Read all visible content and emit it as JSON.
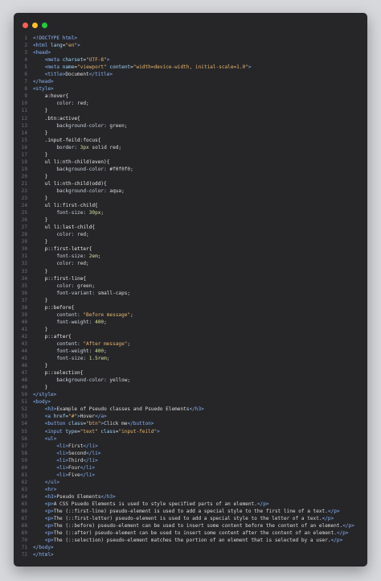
{
  "window": {
    "controls": [
      {
        "name": "close",
        "color": "#ff5f56"
      },
      {
        "name": "minimize",
        "color": "#ffbd2e"
      },
      {
        "name": "maximize",
        "color": "#27c93f"
      }
    ]
  },
  "code_lines": [
    [
      [
        "tag",
        "<!DOCTYPE html>"
      ]
    ],
    [
      [
        "tag",
        "<html "
      ],
      [
        "attr",
        "lang"
      ],
      [
        "plain",
        "="
      ],
      [
        "str",
        "\"en\""
      ],
      [
        "tag",
        ">"
      ]
    ],
    [
      [
        "tag",
        "<head>"
      ]
    ],
    [
      [
        "plain",
        "    "
      ],
      [
        "tag",
        "<meta "
      ],
      [
        "attr",
        "charset"
      ],
      [
        "plain",
        "="
      ],
      [
        "str",
        "\"UTF-8\""
      ],
      [
        "tag",
        ">"
      ]
    ],
    [
      [
        "plain",
        "    "
      ],
      [
        "tag",
        "<meta "
      ],
      [
        "attr",
        "name"
      ],
      [
        "plain",
        "="
      ],
      [
        "str",
        "\"viewport\""
      ],
      [
        "plain",
        " "
      ],
      [
        "attr",
        "content"
      ],
      [
        "plain",
        "="
      ],
      [
        "str",
        "\"width=device-width, initial-scale=1.0\""
      ],
      [
        "tag",
        ">"
      ]
    ],
    [
      [
        "plain",
        "    "
      ],
      [
        "tag",
        "<title>"
      ],
      [
        "plain",
        "Document"
      ],
      [
        "tag",
        "</title>"
      ]
    ],
    [
      [
        "tag",
        "</head>"
      ]
    ],
    [
      [
        "tag",
        "<style>"
      ]
    ],
    [
      [
        "plain",
        "    "
      ],
      [
        "sel",
        "a:hover{"
      ]
    ],
    [
      [
        "plain",
        "        "
      ],
      [
        "prop",
        "color"
      ],
      [
        "plain",
        ": "
      ],
      [
        "plain",
        "red;"
      ]
    ],
    [
      [
        "plain",
        "    "
      ],
      [
        "sel",
        "}"
      ]
    ],
    [
      [
        "plain",
        "    "
      ],
      [
        "sel",
        ".btn:active{"
      ]
    ],
    [
      [
        "plain",
        "        "
      ],
      [
        "prop",
        "background-color"
      ],
      [
        "plain",
        ": "
      ],
      [
        "plain",
        "green;"
      ]
    ],
    [
      [
        "plain",
        "    "
      ],
      [
        "sel",
        "}"
      ]
    ],
    [
      [
        "plain",
        "    "
      ],
      [
        "sel",
        ".input-feild:focus{"
      ]
    ],
    [
      [
        "plain",
        "        "
      ],
      [
        "prop",
        "border"
      ],
      [
        "plain",
        ": "
      ],
      [
        "num",
        "3px"
      ],
      [
        "plain",
        " solid red;"
      ]
    ],
    [
      [
        "plain",
        "    "
      ],
      [
        "sel",
        "}"
      ]
    ],
    [
      [
        "plain",
        "    "
      ],
      [
        "sel",
        "ul li:nth-child(even){"
      ]
    ],
    [
      [
        "plain",
        "        "
      ],
      [
        "prop",
        "background-color"
      ],
      [
        "plain",
        ": "
      ],
      [
        "plain",
        "#f0f0f0;"
      ]
    ],
    [
      [
        "plain",
        "    "
      ],
      [
        "sel",
        "}"
      ]
    ],
    [
      [
        "plain",
        "    "
      ],
      [
        "sel",
        "ul li:nth-child(odd){"
      ]
    ],
    [
      [
        "plain",
        "        "
      ],
      [
        "prop",
        "background-color"
      ],
      [
        "plain",
        ": "
      ],
      [
        "plain",
        "aqua;"
      ]
    ],
    [
      [
        "plain",
        "    "
      ],
      [
        "sel",
        "}"
      ]
    ],
    [
      [
        "plain",
        "    "
      ],
      [
        "sel",
        "ul li:first-child{"
      ]
    ],
    [
      [
        "plain",
        "        "
      ],
      [
        "prop",
        "font-size"
      ],
      [
        "plain",
        ": "
      ],
      [
        "num",
        "30px"
      ],
      [
        "plain",
        ";"
      ]
    ],
    [
      [
        "plain",
        "    "
      ],
      [
        "sel",
        "}"
      ]
    ],
    [
      [
        "plain",
        "    "
      ],
      [
        "sel",
        "ul li:last-child{"
      ]
    ],
    [
      [
        "plain",
        "        "
      ],
      [
        "prop",
        "color"
      ],
      [
        "plain",
        ": "
      ],
      [
        "plain",
        "red;"
      ]
    ],
    [
      [
        "plain",
        "    "
      ],
      [
        "sel",
        "}"
      ]
    ],
    [
      [
        "plain",
        "    "
      ],
      [
        "sel",
        "p::first-letter{"
      ]
    ],
    [
      [
        "plain",
        "        "
      ],
      [
        "prop",
        "font-size"
      ],
      [
        "plain",
        ": "
      ],
      [
        "num",
        "2em"
      ],
      [
        "plain",
        ";"
      ]
    ],
    [
      [
        "plain",
        "        "
      ],
      [
        "prop",
        "color"
      ],
      [
        "plain",
        ": "
      ],
      [
        "plain",
        "red;"
      ]
    ],
    [
      [
        "plain",
        "    "
      ],
      [
        "sel",
        "}"
      ]
    ],
    [
      [
        "plain",
        "    "
      ],
      [
        "sel",
        "p::first-line{"
      ]
    ],
    [
      [
        "plain",
        "        "
      ],
      [
        "prop",
        "color"
      ],
      [
        "plain",
        ": "
      ],
      [
        "plain",
        "green;"
      ]
    ],
    [
      [
        "plain",
        "        "
      ],
      [
        "prop",
        "font-variant"
      ],
      [
        "plain",
        ": "
      ],
      [
        "plain",
        "small-caps;"
      ]
    ],
    [
      [
        "plain",
        "    "
      ],
      [
        "sel",
        "}"
      ]
    ],
    [
      [
        "plain",
        "    "
      ],
      [
        "sel",
        "p::before{"
      ]
    ],
    [
      [
        "plain",
        "        "
      ],
      [
        "prop",
        "content"
      ],
      [
        "plain",
        ": "
      ],
      [
        "str",
        "\"Before message\""
      ],
      [
        "plain",
        ";"
      ]
    ],
    [
      [
        "plain",
        "        "
      ],
      [
        "prop",
        "font-weight"
      ],
      [
        "plain",
        ": "
      ],
      [
        "num",
        "400"
      ],
      [
        "plain",
        ";"
      ]
    ],
    [
      [
        "plain",
        "    "
      ],
      [
        "sel",
        "}"
      ]
    ],
    [
      [
        "plain",
        "    "
      ],
      [
        "sel",
        "p::after{"
      ]
    ],
    [
      [
        "plain",
        "        "
      ],
      [
        "prop",
        "content"
      ],
      [
        "plain",
        ": "
      ],
      [
        "str",
        "\"After message\""
      ],
      [
        "plain",
        ";"
      ]
    ],
    [
      [
        "plain",
        "        "
      ],
      [
        "prop",
        "font-weight"
      ],
      [
        "plain",
        ": "
      ],
      [
        "num",
        "400"
      ],
      [
        "plain",
        ";"
      ]
    ],
    [
      [
        "plain",
        "        "
      ],
      [
        "prop",
        "font-size"
      ],
      [
        "plain",
        ": "
      ],
      [
        "num",
        "1.5rem"
      ],
      [
        "plain",
        ";"
      ]
    ],
    [
      [
        "plain",
        "    "
      ],
      [
        "sel",
        "}"
      ]
    ],
    [
      [
        "plain",
        "    "
      ],
      [
        "sel",
        "p::selection{"
      ]
    ],
    [
      [
        "plain",
        "        "
      ],
      [
        "prop",
        "background-color"
      ],
      [
        "plain",
        ": "
      ],
      [
        "plain",
        "yellow;"
      ]
    ],
    [
      [
        "plain",
        "    "
      ],
      [
        "sel",
        "}"
      ]
    ],
    [
      [
        "tag",
        "</style>"
      ]
    ],
    [
      [
        "tag",
        "<body>"
      ]
    ],
    [
      [
        "plain",
        "    "
      ],
      [
        "tag",
        "<h3>"
      ],
      [
        "plain",
        "Example of Pseudo classes and Psuedo Elements"
      ],
      [
        "tag",
        "</h3>"
      ]
    ],
    [
      [
        "plain",
        "    "
      ],
      [
        "tag",
        "<a "
      ],
      [
        "attr",
        "href"
      ],
      [
        "plain",
        "="
      ],
      [
        "str",
        "\"#\""
      ],
      [
        "tag",
        ">"
      ],
      [
        "plain",
        "Hover"
      ],
      [
        "tag",
        "</a>"
      ]
    ],
    [
      [
        "plain",
        "    "
      ],
      [
        "tag",
        "<button "
      ],
      [
        "attr",
        "class"
      ],
      [
        "plain",
        "="
      ],
      [
        "str",
        "\"btn\""
      ],
      [
        "tag",
        ">"
      ],
      [
        "plain",
        "Click me"
      ],
      [
        "tag",
        "</button>"
      ]
    ],
    [
      [
        "plain",
        "    "
      ],
      [
        "tag",
        "<input "
      ],
      [
        "attr",
        "type"
      ],
      [
        "plain",
        "="
      ],
      [
        "str",
        "\"text\""
      ],
      [
        "plain",
        " "
      ],
      [
        "attr",
        "class"
      ],
      [
        "plain",
        "="
      ],
      [
        "str",
        "\"input-feild\""
      ],
      [
        "tag",
        ">"
      ]
    ],
    [
      [
        "plain",
        "    "
      ],
      [
        "tag",
        "<ul>"
      ]
    ],
    [
      [
        "plain",
        "        "
      ],
      [
        "tag",
        "<li>"
      ],
      [
        "plain",
        "First"
      ],
      [
        "tag",
        "</li>"
      ]
    ],
    [
      [
        "plain",
        "        "
      ],
      [
        "tag",
        "<li>"
      ],
      [
        "plain",
        "Second"
      ],
      [
        "tag",
        "</li>"
      ]
    ],
    [
      [
        "plain",
        "        "
      ],
      [
        "tag",
        "<li>"
      ],
      [
        "plain",
        "Third"
      ],
      [
        "tag",
        "</li>"
      ]
    ],
    [
      [
        "plain",
        "        "
      ],
      [
        "tag",
        "<li>"
      ],
      [
        "plain",
        "Four"
      ],
      [
        "tag",
        "</li>"
      ]
    ],
    [
      [
        "plain",
        "        "
      ],
      [
        "tag",
        "<li>"
      ],
      [
        "plain",
        "Five"
      ],
      [
        "tag",
        "</li>"
      ]
    ],
    [
      [
        "plain",
        "    "
      ],
      [
        "tag",
        "</ul>"
      ]
    ],
    [
      [
        "plain",
        "    "
      ],
      [
        "tag",
        "<hr>"
      ]
    ],
    [
      [
        "plain",
        "    "
      ],
      [
        "tag",
        "<h3>"
      ],
      [
        "plain",
        "Pseudo Elements"
      ],
      [
        "tag",
        "</h3>"
      ]
    ],
    [
      [
        "plain",
        "    "
      ],
      [
        "tag",
        "<p>"
      ],
      [
        "plain",
        "A CSS Psuedo Elements is used to style specified parts of an element."
      ],
      [
        "tag",
        "</p>"
      ]
    ],
    [
      [
        "plain",
        "    "
      ],
      [
        "tag",
        "<p>"
      ],
      [
        "plain",
        "The (::first-line) pseudo-element is used to add a special style to the first line of a text."
      ],
      [
        "tag",
        "</p>"
      ]
    ],
    [
      [
        "plain",
        "    "
      ],
      [
        "tag",
        "<p>"
      ],
      [
        "plain",
        "The (::first-letter) pseudo-element is used to add a special style to the letter of a text."
      ],
      [
        "tag",
        "</p>"
      ]
    ],
    [
      [
        "plain",
        "    "
      ],
      [
        "tag",
        "<p>"
      ],
      [
        "plain",
        "The (::before) pseudo-element can be used to insert some content before the content of an element."
      ],
      [
        "tag",
        "</p>"
      ]
    ],
    [
      [
        "plain",
        "    "
      ],
      [
        "tag",
        "<p>"
      ],
      [
        "plain",
        "The (::after) pseudo-element can be used to insert some content after the content of an element."
      ],
      [
        "tag",
        "</p>"
      ]
    ],
    [
      [
        "plain",
        "    "
      ],
      [
        "tag",
        "<p>"
      ],
      [
        "plain",
        "The (::selection) pseudo-element matches the portion of an element that is selected by a user."
      ],
      [
        "tag",
        "</p>"
      ]
    ],
    [
      [
        "tag",
        "</body>"
      ]
    ],
    [
      [
        "tag",
        "</html>"
      ]
    ]
  ]
}
